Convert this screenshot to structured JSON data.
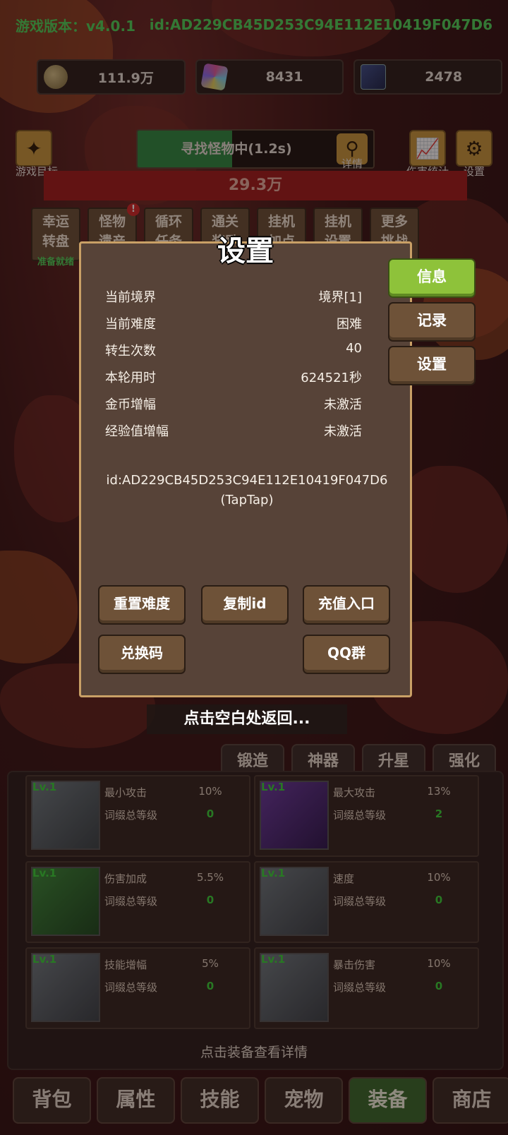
{
  "header": {
    "version": "游戏版本：v4.0.1",
    "id": "id:AD229CB45D253C94E112E10419F047D6"
  },
  "resources": [
    {
      "name": "coin",
      "value": "111.9万"
    },
    {
      "name": "crystal",
      "value": "8431"
    },
    {
      "name": "card",
      "value": "2478"
    }
  ],
  "toolbar": {
    "goal_label": "游戏目标",
    "search_text": "寻找怪物中(1.2s)",
    "search_progress": 0.4,
    "detail_label": "详情",
    "stats_label": "伤害统计",
    "settings_label": "设置",
    "hp_value": "29.3万"
  },
  "features": [
    {
      "l1": "幸运",
      "l2": "转盘",
      "sub": "准备就绪"
    },
    {
      "l1": "怪物",
      "l2": "遗产"
    },
    {
      "l1": "循环",
      "l2": "任务"
    },
    {
      "l1": "通关",
      "l2": "奖励"
    },
    {
      "l1": "挂机",
      "l2": "加点"
    },
    {
      "l1": "挂机",
      "l2": "设置"
    },
    {
      "l1": "更多",
      "l2": "挑战"
    }
  ],
  "feature_alert": "!",
  "modal": {
    "title": "设置",
    "rows": [
      {
        "label": "当前境界",
        "value": "境界[1]"
      },
      {
        "label": "当前难度",
        "value": "困难"
      },
      {
        "label": "转生次数",
        "value": "40"
      },
      {
        "label": "本轮用时",
        "value": "624521秒"
      },
      {
        "label": "金币增幅",
        "value": "未激活"
      },
      {
        "label": "经验值增幅",
        "value": "未激活"
      }
    ],
    "id_text": "id:AD229CB45D253C94E112E10419F047D6(TapTap)",
    "buttons": {
      "reset": "重置难度",
      "copy": "复制id",
      "recharge": "充值入口",
      "redeem": "兑换码",
      "qq": "QQ群"
    },
    "side_tabs": [
      "信息",
      "记录",
      "设置"
    ],
    "close_hint": "点击空白处返回..."
  },
  "sub_tabs": [
    "锻造",
    "神器",
    "升星",
    "强化"
  ],
  "equipment": [
    {
      "lv": "Lv.1",
      "k1": "最小攻击",
      "v1": "10%",
      "k2": "词缀总等级",
      "v2": "0",
      "icon": "sword-icon"
    },
    {
      "lv": "Lv.1",
      "k1": "最大攻击",
      "v1": "13%",
      "k2": "词缀总等级",
      "v2": "2",
      "icon": "helmet-icon"
    },
    {
      "lv": "Lv.1",
      "k1": "伤害加成",
      "v1": "5.5%",
      "k2": "词缀总等级",
      "v2": "0",
      "icon": "armor-icon"
    },
    {
      "lv": "Lv.1",
      "k1": "速度",
      "v1": "10%",
      "k2": "词缀总等级",
      "v2": "0",
      "icon": "boots-icon"
    },
    {
      "lv": "Lv.1",
      "k1": "技能增幅",
      "v1": "5%",
      "k2": "词缀总等级",
      "v2": "0",
      "icon": "ring-icon"
    },
    {
      "lv": "Lv.1",
      "k1": "暴击伤害",
      "v1": "10%",
      "k2": "词缀总等级",
      "v2": "0",
      "icon": "necklace-icon"
    }
  ],
  "equip_hint": "点击装备查看详情",
  "nav": [
    "背包",
    "属性",
    "技能",
    "宠物",
    "装备",
    "商店"
  ],
  "colors": {
    "accent_green": "#4fd35a",
    "active_tab": "#8ec23a",
    "hp_bar": "#a21d1d"
  }
}
